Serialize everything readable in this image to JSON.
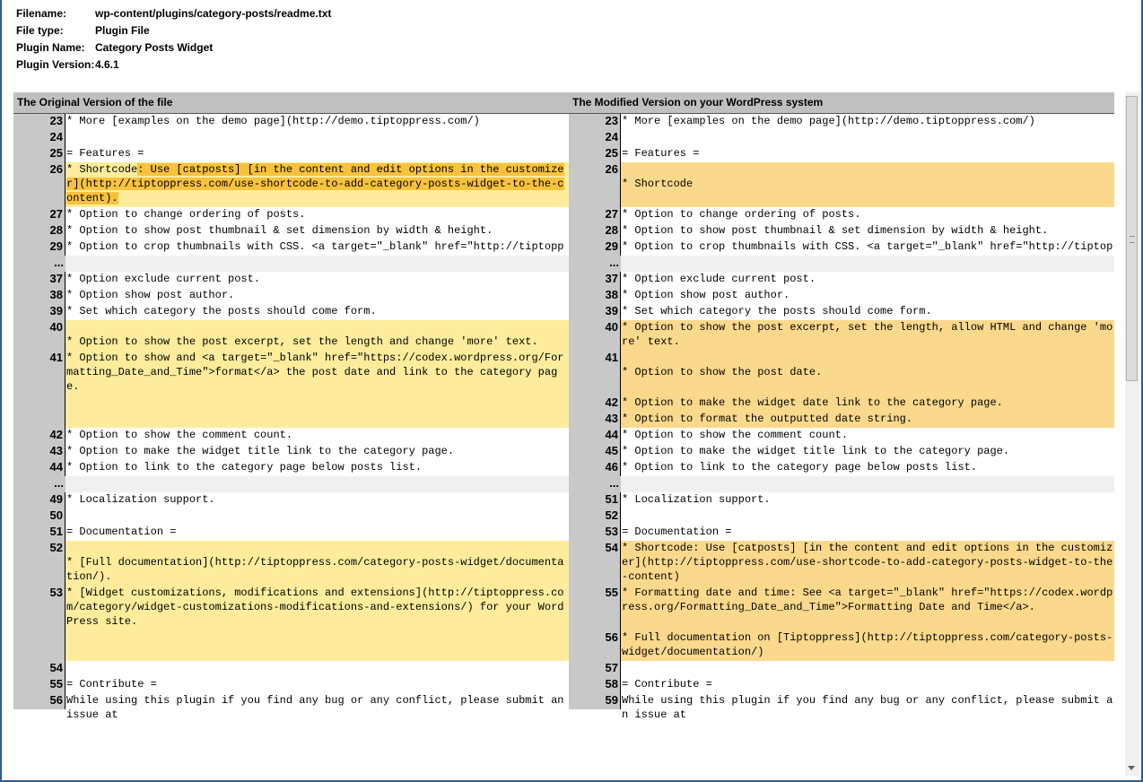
{
  "meta": {
    "filename_label": "Filename:",
    "filename": "wp-content/plugins/category-posts/readme.txt",
    "filetype_label": "File type:",
    "filetype": "Plugin File",
    "pluginname_label": "Plugin Name:",
    "pluginname": "Category Posts Widget",
    "pluginversion_label": "Plugin Version:",
    "pluginversion": "4.6.1"
  },
  "headers": {
    "left": "The Original Version of the file",
    "right": "The Modified Version on your WordPress system"
  },
  "rows": [
    {
      "type": "same",
      "left": [
        {
          "n": "23",
          "t": "* More [examples on the demo page](http://demo.tiptoppress.com/)"
        }
      ],
      "right": [
        {
          "n": "23",
          "t": "* More [examples on the demo page](http://demo.tiptoppress.com/)"
        }
      ]
    },
    {
      "type": "same",
      "left": [
        {
          "n": "24",
          "t": ""
        }
      ],
      "right": [
        {
          "n": "24",
          "t": ""
        }
      ]
    },
    {
      "type": "same",
      "left": [
        {
          "n": "25",
          "t": "= Features ="
        }
      ],
      "right": [
        {
          "n": "25",
          "t": "= Features ="
        }
      ]
    },
    {
      "type": "chg",
      "h": 50,
      "left": [
        {
          "n": "26",
          "t": "* Shortcode",
          "hl": ": Use [catposts] [in the content and edit options in the customizer](http://tiptoppress.com/use-shortcode-to-add-category-posts-widget-to-the-content)."
        }
      ],
      "right": [
        {
          "n": "26",
          "t": "\n* Shortcode"
        }
      ]
    },
    {
      "type": "same",
      "left": [
        {
          "n": "27",
          "t": "* Option to change ordering of posts."
        }
      ],
      "right": [
        {
          "n": "27",
          "t": "* Option to change ordering of posts."
        }
      ]
    },
    {
      "type": "same",
      "left": [
        {
          "n": "28",
          "t": "* Option to show post thumbnail & set dimension by width & height."
        }
      ],
      "right": [
        {
          "n": "28",
          "t": "* Option to show post thumbnail & set dimension by width & height."
        }
      ]
    },
    {
      "type": "same",
      "left": [
        {
          "n": "29",
          "t": "* Option to crop thumbnails with CSS. <a target=\"_blank\" href=\"http://tiptoppress.com/css-image-crop/\">What is 'CSS Image Crop'?</a>"
        }
      ],
      "right": [
        {
          "n": "29",
          "t": "* Option to crop thumbnails with CSS. <a target=\"_blank\" href=\"http://tiptoppress.com/css-image-crop/\">What is 'CSS Image Crop'?</a>"
        }
      ]
    },
    {
      "type": "sep",
      "left": [
        {
          "n": "...",
          "t": ""
        }
      ],
      "right": [
        {
          "n": "...",
          "t": ""
        }
      ]
    },
    {
      "type": "same",
      "left": [
        {
          "n": "37",
          "t": "* Option exclude current post."
        }
      ],
      "right": [
        {
          "n": "37",
          "t": "* Option exclude current post."
        }
      ]
    },
    {
      "type": "same",
      "left": [
        {
          "n": "38",
          "t": "* Option show post author."
        }
      ],
      "right": [
        {
          "n": "38",
          "t": "* Option show post author."
        }
      ]
    },
    {
      "type": "same",
      "left": [
        {
          "n": "39",
          "t": "* Set which category the posts should come form."
        }
      ],
      "right": [
        {
          "n": "39",
          "t": "* Set which category the posts should come form."
        }
      ]
    },
    {
      "type": "chg",
      "h": 120,
      "left": [
        {
          "n": "40",
          "t": "\n* Option to show the post excerpt, set the length and change 'more' text.",
          "h": 34
        },
        {
          "n": "41",
          "t": "* Option to show and <a target=\"_blank\" href=\"https://codex.wordpress.org/Formatting_Date_and_Time\">format</a> the post date and link to the category page."
        }
      ],
      "right": [
        {
          "n": "40",
          "t": "* Option to show the post excerpt, set the length, allow HTML and change 'more' text.",
          "h": 34
        },
        {
          "n": "41",
          "t": "\n* Option to show the post date.",
          "h": 50
        },
        {
          "n": "42",
          "t": "* Option to make the widget date link to the category page."
        },
        {
          "n": "43",
          "t": "* Option to format the outputted date string."
        }
      ]
    },
    {
      "type": "same",
      "left": [
        {
          "n": "42",
          "t": "* Option to show the comment count."
        }
      ],
      "right": [
        {
          "n": "44",
          "t": "* Option to show the comment count."
        }
      ]
    },
    {
      "type": "same",
      "left": [
        {
          "n": "43",
          "t": "* Option to make the widget title link to the category page."
        }
      ],
      "right": [
        {
          "n": "45",
          "t": "* Option to make the widget title link to the category page."
        }
      ]
    },
    {
      "type": "same",
      "left": [
        {
          "n": "44",
          "t": "* Option to link to the category page below posts list."
        }
      ],
      "right": [
        {
          "n": "46",
          "t": "* Option to link to the category page below posts list."
        }
      ]
    },
    {
      "type": "sep",
      "left": [
        {
          "n": "...",
          "t": ""
        }
      ],
      "right": [
        {
          "n": "...",
          "t": ""
        }
      ]
    },
    {
      "type": "same",
      "left": [
        {
          "n": "49",
          "t": "* Localization support."
        }
      ],
      "right": [
        {
          "n": "51",
          "t": "* Localization support."
        }
      ]
    },
    {
      "type": "same",
      "left": [
        {
          "n": "50",
          "t": ""
        }
      ],
      "right": [
        {
          "n": "52",
          "t": ""
        }
      ]
    },
    {
      "type": "same",
      "left": [
        {
          "n": "51",
          "t": "= Documentation ="
        }
      ],
      "right": [
        {
          "n": "53",
          "t": "= Documentation ="
        }
      ]
    },
    {
      "type": "chg",
      "h": 134,
      "left": [
        {
          "n": "52",
          "t": "\n* [Full documentation](http://tiptoppress.com/category-posts-widget/documentation/).",
          "h": 50
        },
        {
          "n": "53",
          "t": "* [Widget customizations, modifications and extensions](http://tiptoppress.com/category/widget-customizations-modifications-and-extensions/) for your WordPress site."
        }
      ],
      "right": [
        {
          "n": "54",
          "t": "* Shortcode: Use [catposts] [in the content and edit options in the customizer](http://tiptoppress.com/use-shortcode-to-add-category-posts-widget-to-the-content)",
          "h": 50
        },
        {
          "n": "55",
          "t": "* Formatting date and time: See <a target=\"_blank\" href=\"https://codex.wordpress.org/Formatting_Date_and_Time\">Formatting Date and Time</a>.",
          "h": 50
        },
        {
          "n": "56",
          "t": "* Full documentation on [Tiptoppress](http://tiptoppress.com/category-posts-widget/documentation/)"
        }
      ]
    },
    {
      "type": "same",
      "left": [
        {
          "n": "54",
          "t": ""
        }
      ],
      "right": [
        {
          "n": "57",
          "t": ""
        }
      ]
    },
    {
      "type": "same",
      "left": [
        {
          "n": "55",
          "t": "= Contribute ="
        }
      ],
      "right": [
        {
          "n": "58",
          "t": "= Contribute ="
        }
      ]
    },
    {
      "type": "same",
      "left": [
        {
          "n": "56",
          "t": "While using this plugin if you find any bug or any conflict, please submit an issue at"
        }
      ],
      "right": [
        {
          "n": "59",
          "t": "While using this plugin if you find any bug or any conflict, please submit an issue at"
        }
      ]
    }
  ]
}
